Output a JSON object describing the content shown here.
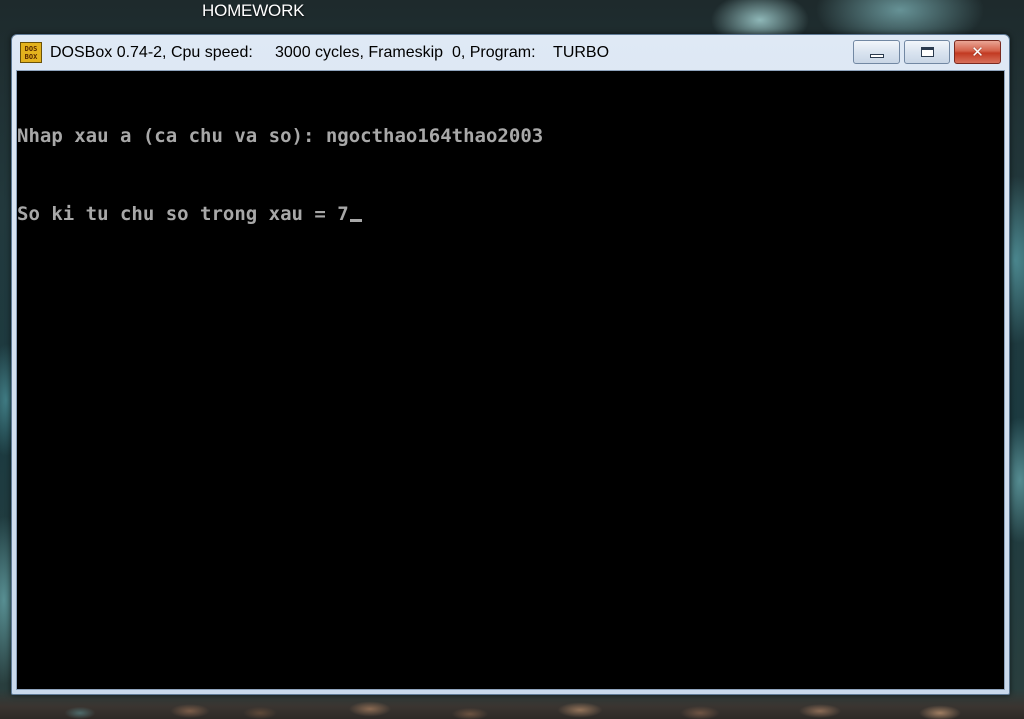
{
  "desktop": {
    "folder_label": "HOMEWORK"
  },
  "window": {
    "title": "DOSBox 0.74-2, Cpu speed:     3000 cycles, Frameskip  0, Program:    TURBO",
    "icon": "dosbox-icon",
    "icon_text_top": "DOS",
    "icon_text_bottom": "BOX",
    "controls": {
      "minimize": "minimize-icon",
      "maximize": "maximize-icon",
      "close": "close-icon",
      "close_glyph": "✕",
      "close_color": "#c23a22"
    }
  },
  "console": {
    "lines": [
      "Nhap xau a (ca chu va so): ngocthao164thao2003",
      "So ki tu chu so trong xau = 7"
    ],
    "text_color": "#a8a8a8",
    "background": "#000000"
  }
}
